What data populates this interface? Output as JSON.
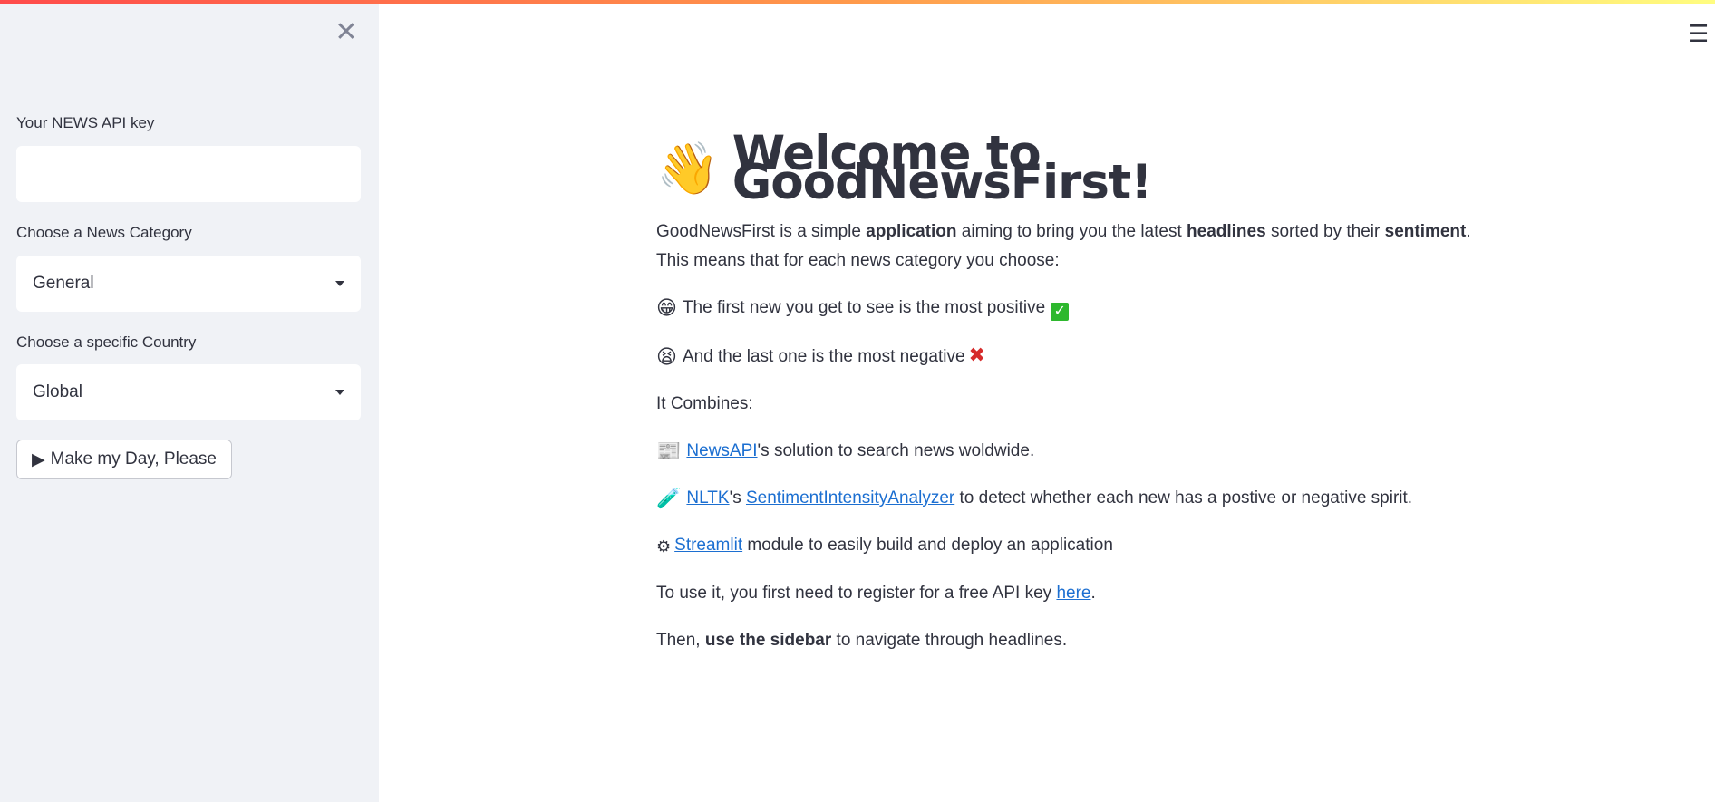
{
  "sidebar": {
    "close_icon": "close-icon",
    "api_key_label": "Your NEWS API key",
    "api_key_value": "",
    "category_label": "Choose a News Category",
    "category_value": "General",
    "country_label": "Choose a specific Country",
    "country_value": "Global",
    "run_button_icon": "▶",
    "run_button_label": "Make my Day, Please"
  },
  "header": {
    "menu_icon": "hamburger-menu-icon"
  },
  "main": {
    "hero_emoji": "👋",
    "title": "Welcome to GoodNewsFirst!",
    "intro": {
      "t1": "GoodNewsFirst is a simple ",
      "b1": "application",
      "t2": " aiming to bring you the latest ",
      "b2": "headlines",
      "t3": " sorted by their ",
      "b3": "sentiment",
      "t4": ".",
      "line2": "This means that for each news category you choose:"
    },
    "positive": {
      "emoji": "😁",
      "text": "The first new you get to see is the most positive",
      "check": "✓"
    },
    "negative": {
      "emoji": "😫",
      "text": "And the last one is the most negative",
      "cross": "✖"
    },
    "combines": "It Combines:",
    "newsapi": {
      "emoji": "📰",
      "link": "NewsAPI",
      "text": "'s solution to search news woldwide."
    },
    "nltk": {
      "emoji": "🧪",
      "link1": "NLTK",
      "mid": "'s ",
      "link2": "SentimentIntensityAnalyzer",
      "text": " to detect whether each new has a postive or negative spirit."
    },
    "streamlit": {
      "emoji": "⚙",
      "link": "Streamlit",
      "text": " module to easily build and deploy an application"
    },
    "register": {
      "text": "To use it, you first need to register for a free API key ",
      "link": "here",
      "end": "."
    },
    "sidebar_hint": {
      "t1": "Then, ",
      "bold": "use the sidebar",
      "t2": " to navigate through headlines."
    }
  },
  "colors": {
    "accent": "#ff4b4b",
    "link": "#1c6fd1",
    "sidebar_bg": "#f0f2f6",
    "text": "#31333f"
  }
}
